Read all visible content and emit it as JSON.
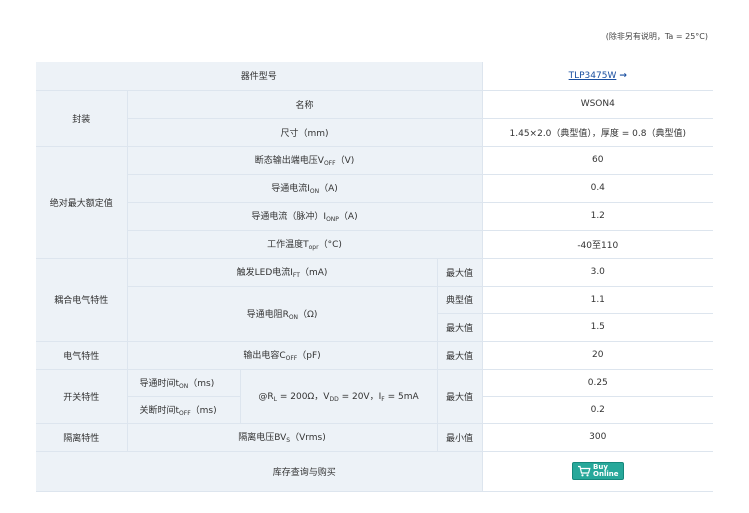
{
  "note": "(除非另有说明，Ta = 25°C)",
  "header": {
    "label": "器件型号",
    "model": "TLP3475W",
    "arrow": "→"
  },
  "package": {
    "group": "封装",
    "name_label": "名称",
    "name_value": "WSON4",
    "size_label": "尺寸（mm)",
    "size_value": "1.45×2.0（典型值），厚度 = 0.8（典型值)"
  },
  "absmax": {
    "group": "绝对最大额定值",
    "voff_pre": "断态输出端电压V",
    "voff_sub": "OFF",
    "voff_post": "（V)",
    "voff_value": "60",
    "ion_pre": "导通电流I",
    "ion_sub": "ON",
    "ion_post": "（A)",
    "ion_value": "0.4",
    "ionp_pre": "导通电流（脉冲）I",
    "ionp_sub": "ONP",
    "ionp_post": "（A)",
    "ionp_value": "1.2",
    "topr_pre": "工作温度T",
    "topr_sub": "opr",
    "topr_post": "（°C)",
    "topr_value": "-40至110"
  },
  "coupled": {
    "group": "耦合电气特性",
    "ift_pre": "触发LED电流I",
    "ift_sub": "FT",
    "ift_post": "（mA)",
    "ift_cond": "最大值",
    "ift_value": "3.0",
    "ron_pre": "导通电阻R",
    "ron_sub": "ON",
    "ron_post": "（Ω)",
    "ron_cond_typ": "典型值",
    "ron_value_typ": "1.1",
    "ron_cond_max": "最大值",
    "ron_value_max": "1.5"
  },
  "electrical": {
    "group": "电气特性",
    "coff_pre": "输出电容C",
    "coff_sub": "OFF",
    "coff_post": "（pF)",
    "coff_cond": "最大值",
    "coff_value": "20"
  },
  "switching": {
    "group": "开关特性",
    "ton_pre": "导通时间t",
    "ton_sub": "ON",
    "ton_post": "（ms)",
    "toff_pre": "关断时间t",
    "toff_sub": "OFF",
    "toff_post": "（ms)",
    "cond_prefix": "@R",
    "rl_sub": "L",
    "rl_text": " = 200Ω，V",
    "vdd_sub": "DD",
    "vdd_text": " = 20V，I",
    "if_sub": "F",
    "if_text": " = 5mA",
    "cond": "最大值",
    "ton_value": "0.25",
    "toff_value": "0.2"
  },
  "isolation": {
    "group": "隔离特性",
    "bv_pre": "隔离电压BV",
    "bv_sub": "S",
    "bv_post": "（Vrms)",
    "bv_cond": "最小值",
    "bv_value": "300"
  },
  "stock": {
    "label": "库存查询与购买",
    "buy_line1": "Buy",
    "buy_line2": "Online",
    "buy_color": "#27a89a"
  }
}
